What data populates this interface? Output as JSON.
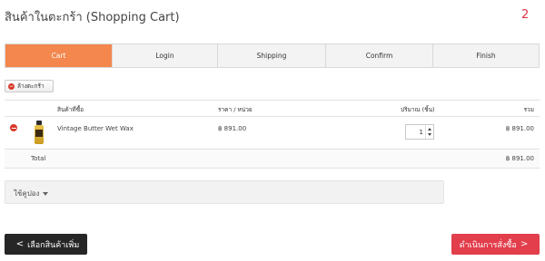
{
  "header": {
    "title": "สินค้าในตะกร้า (Shopping Cart)",
    "cart_count": "2"
  },
  "steps": [
    {
      "label": "Cart",
      "active": true
    },
    {
      "label": "Login",
      "active": false
    },
    {
      "label": "Shipping",
      "active": false
    },
    {
      "label": "Confirm",
      "active": false
    },
    {
      "label": "Finish",
      "active": false
    }
  ],
  "clear_cart": {
    "label": "ล้างตะกร้า"
  },
  "table": {
    "columns": {
      "product": "สินค้าที่ซื้อ",
      "unit_price": "ราคา / หน่วย",
      "quantity": "ปริมาณ (ชิ้น)",
      "total": "รวม"
    },
    "rows": [
      {
        "name": "Vintage Butter Wet Wax",
        "unit_price": "฿ 891.00",
        "quantity": "1",
        "total": "฿ 891.00"
      }
    ],
    "footer": {
      "label": "Total",
      "amount": "฿ 891.00"
    }
  },
  "coupon": {
    "label": "ใช้คูปอง"
  },
  "actions": {
    "back_label": "เลือกสินค้าเพิ่ม",
    "back_icon": "<",
    "next_label": "ดำเนินการสั่งซื้อ",
    "next_icon": ">"
  },
  "colors": {
    "active_step": "#f3874d",
    "checkout_button": "#e23e4c",
    "back_button": "#262626",
    "cart_count": "#e0334a"
  }
}
